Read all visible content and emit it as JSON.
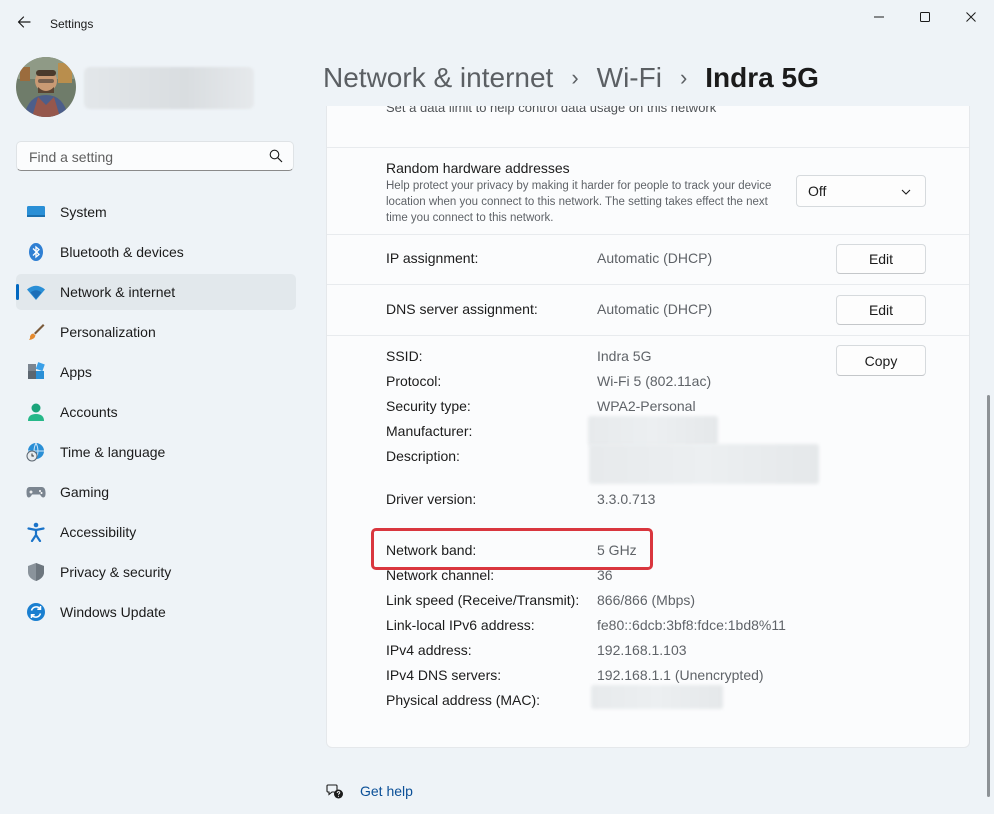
{
  "window": {
    "app_title": "Settings",
    "controls": [
      "minimize-icon",
      "maximize-icon",
      "close-icon"
    ]
  },
  "search": {
    "placeholder": "Find a setting"
  },
  "sidebar": {
    "items": [
      {
        "label": "System",
        "icon": "system-icon",
        "selected": false
      },
      {
        "label": "Bluetooth & devices",
        "icon": "bluetooth-icon",
        "selected": false
      },
      {
        "label": "Network & internet",
        "icon": "wifi-icon",
        "selected": true
      },
      {
        "label": "Personalization",
        "icon": "brush-icon",
        "selected": false
      },
      {
        "label": "Apps",
        "icon": "apps-icon",
        "selected": false
      },
      {
        "label": "Accounts",
        "icon": "account-icon",
        "selected": false
      },
      {
        "label": "Time & language",
        "icon": "globe-clock-icon",
        "selected": false
      },
      {
        "label": "Gaming",
        "icon": "gamepad-icon",
        "selected": false
      },
      {
        "label": "Accessibility",
        "icon": "accessibility-icon",
        "selected": false
      },
      {
        "label": "Privacy & security",
        "icon": "shield-icon",
        "selected": false
      },
      {
        "label": "Windows Update",
        "icon": "update-icon",
        "selected": false
      }
    ]
  },
  "breadcrumb": [
    "Network & internet",
    "Wi-Fi",
    "Indra 5G"
  ],
  "content": {
    "data_limit_desc": "Set a data limit to help control data usage on this network",
    "random_hw": {
      "title": "Random hardware addresses",
      "desc": "Help protect your privacy by making it harder for people to track your device location when you connect to this network. The setting takes effect the next time you connect to this network.",
      "value": "Off"
    },
    "ip": {
      "label": "IP assignment:",
      "value": "Automatic (DHCP)",
      "button": "Edit"
    },
    "dns": {
      "label": "DNS server assignment:",
      "value": "Automatic (DHCP)",
      "button": "Edit"
    },
    "copy_button": "Copy",
    "props": {
      "ssid": {
        "label": "SSID:",
        "value": "Indra 5G"
      },
      "protocol": {
        "label": "Protocol:",
        "value": "Wi-Fi 5 (802.11ac)"
      },
      "security": {
        "label": "Security type:",
        "value": "WPA2-Personal"
      },
      "manufacturer": {
        "label": "Manufacturer:"
      },
      "description": {
        "label": "Description:"
      },
      "driver": {
        "label": "Driver version:",
        "value": "3.3.0.713"
      },
      "band": {
        "label": "Network band:",
        "value": "5 GHz"
      },
      "channel": {
        "label": "Network channel:",
        "value": "36"
      },
      "link_speed": {
        "label": "Link speed (Receive/Transmit):",
        "value": "866/866 (Mbps)"
      },
      "ipv6": {
        "label": "Link-local IPv6 address:",
        "value": "fe80::6dcb:3bf8:fdce:1bd8%11"
      },
      "ipv4": {
        "label": "IPv4 address:",
        "value": "192.168.1.103"
      },
      "ipv4_dns": {
        "label": "IPv4 DNS servers:",
        "value": "192.168.1.1 (Unencrypted)"
      },
      "mac": {
        "label": "Physical address (MAC):"
      }
    }
  },
  "help": {
    "label": "Get help"
  },
  "colors": {
    "accent": "#0067c0",
    "highlight": "#d9363e"
  }
}
